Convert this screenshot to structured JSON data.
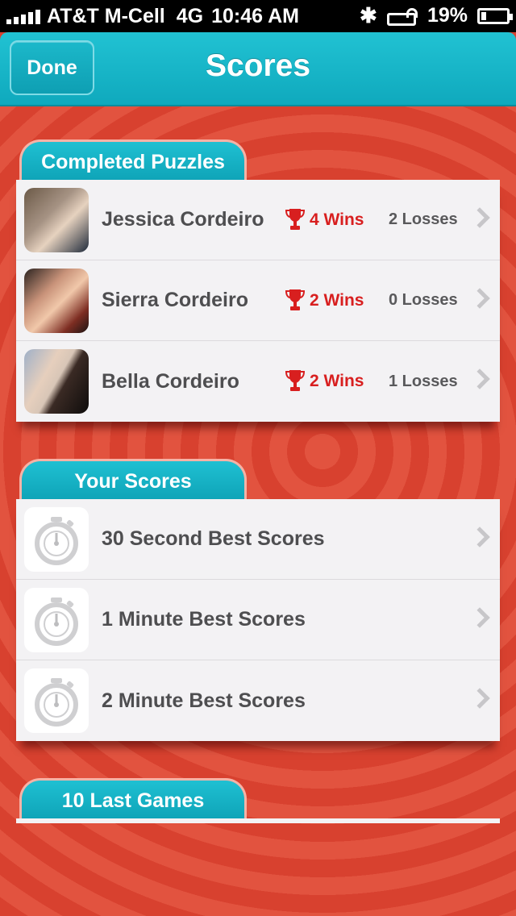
{
  "status_bar": {
    "carrier": "AT&T M-Cell",
    "network": "4G",
    "time": "10:46 AM",
    "battery": "19%"
  },
  "nav": {
    "done_label": "Done",
    "title": "Scores"
  },
  "completed_puzzles": {
    "header": "Completed Puzzles",
    "rows": [
      {
        "name": "Jessica Cordeiro",
        "wins": "4 Wins",
        "losses": "2 Losses"
      },
      {
        "name": "Sierra Cordeiro",
        "wins": "2 Wins",
        "losses": "0 Losses"
      },
      {
        "name": "Bella Cordeiro",
        "wins": "2 Wins",
        "losses": "1 Losses"
      }
    ]
  },
  "your_scores": {
    "header": "Your Scores",
    "rows": [
      {
        "label": "30 Second Best Scores"
      },
      {
        "label": "1 Minute Best Scores"
      },
      {
        "label": "2 Minute Best Scores"
      }
    ]
  },
  "last_games": {
    "header": "10 Last Games"
  },
  "colors": {
    "accent": "#12b0c4",
    "background": "#dd4a37",
    "wins": "#d81f1f"
  }
}
